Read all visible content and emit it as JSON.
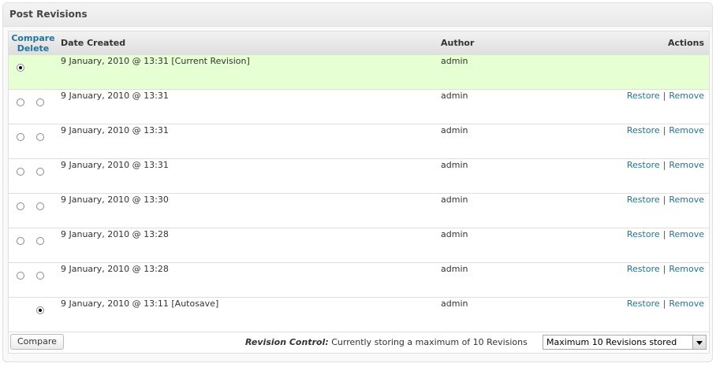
{
  "box": {
    "title": "Post Revisions"
  },
  "table": {
    "headers": {
      "compare": "Compare",
      "delete": "Delete",
      "date": "Date Created",
      "author": "Author",
      "actions": "Actions"
    },
    "rows": [
      {
        "date": "9 January, 2010 @ 13:31 [Current Revision]",
        "author": "admin",
        "current": true,
        "compare_checked": true
      },
      {
        "date": "9 January, 2010 @ 13:31",
        "author": "admin",
        "restore": "Restore",
        "separator": "|",
        "remove": "Remove"
      },
      {
        "date": "9 January, 2010 @ 13:31",
        "author": "admin",
        "restore": "Restore",
        "separator": "|",
        "remove": "Remove"
      },
      {
        "date": "9 January, 2010 @ 13:31",
        "author": "admin",
        "restore": "Restore",
        "separator": "|",
        "remove": "Remove"
      },
      {
        "date": "9 January, 2010 @ 13:30",
        "author": "admin",
        "restore": "Restore",
        "separator": "|",
        "remove": "Remove"
      },
      {
        "date": "9 January, 2010 @ 13:28",
        "author": "admin",
        "restore": "Restore",
        "separator": "|",
        "remove": "Remove"
      },
      {
        "date": "9 January, 2010 @ 13:28",
        "author": "admin",
        "restore": "Restore",
        "separator": "|",
        "remove": "Remove"
      },
      {
        "date": "9 January, 2010 @ 13:11 [Autosave]",
        "author": "admin",
        "restore": "Restore",
        "separator": "|",
        "remove": "Remove",
        "autosave": true,
        "delete_checked": true
      }
    ]
  },
  "footer": {
    "compare_button": "Compare",
    "status_label": "Revision Control:",
    "status_text": "Currently storing a maximum of 10 Revisions",
    "select_value": "Maximum 10 Revisions stored"
  },
  "colors": {
    "link": "#21759b",
    "current_row": "#e6ffd3",
    "border": "#dfdfdf"
  }
}
